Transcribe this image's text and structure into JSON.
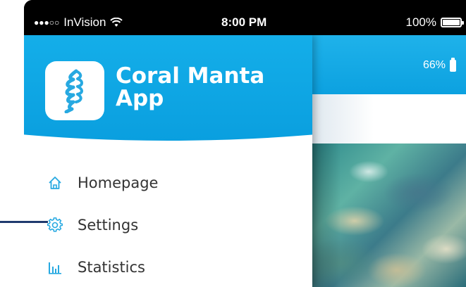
{
  "status_bar": {
    "carrier": "InVision",
    "signal": "●●●○○",
    "time": "8:00 PM",
    "battery": "100%"
  },
  "drawer": {
    "app_title": "Coral Manta App",
    "logo_icon": "coral-feather-logo",
    "items": [
      {
        "label": "Homepage",
        "icon": "home-icon"
      },
      {
        "label": "Settings",
        "icon": "gear-icon"
      },
      {
        "label": "Statistics",
        "icon": "bar-chart-icon"
      }
    ]
  },
  "main": {
    "battery_level": "66%"
  },
  "colors": {
    "accent": "#0ca1e0",
    "icon": "#27a9e1",
    "text": "#333333",
    "callout": "#1f3a6e"
  }
}
